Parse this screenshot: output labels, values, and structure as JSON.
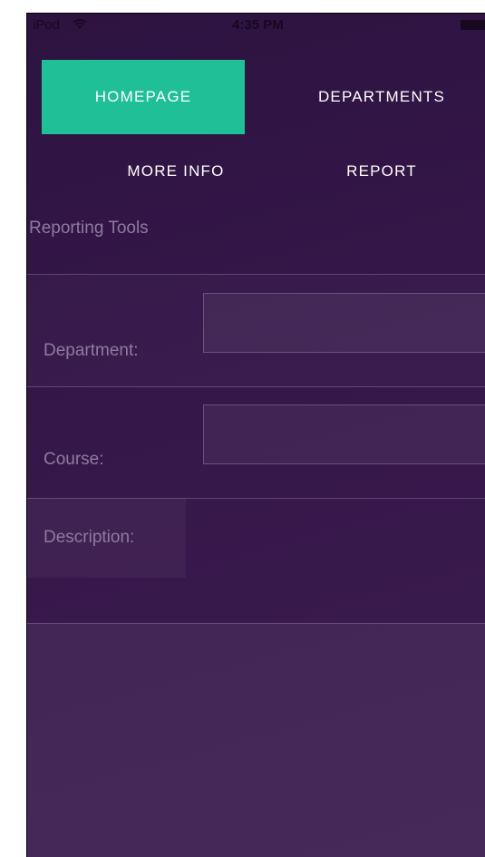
{
  "status_bar": {
    "carrier": "iPod",
    "time": "4:35 PM"
  },
  "nav": {
    "homepage": "HOMEPAGE",
    "departments": "DEPARTMENTS",
    "more_info": "MORE INFO",
    "report": "REPORT",
    "active": "HOMEPAGE",
    "active_color": "#1fbf97"
  },
  "page": {
    "title": "Reporting Tools"
  },
  "form": {
    "department_label": "Department:",
    "department_value": "",
    "course_label": "Course:",
    "course_value": "",
    "description_label": "Description:",
    "description_value": ""
  },
  "colors": {
    "background": "#36174a",
    "label_text": "#8f7a9e",
    "nav_text": "#ffffff"
  },
  "icons": {
    "wifi": "wifi-icon",
    "battery": "battery-icon"
  }
}
